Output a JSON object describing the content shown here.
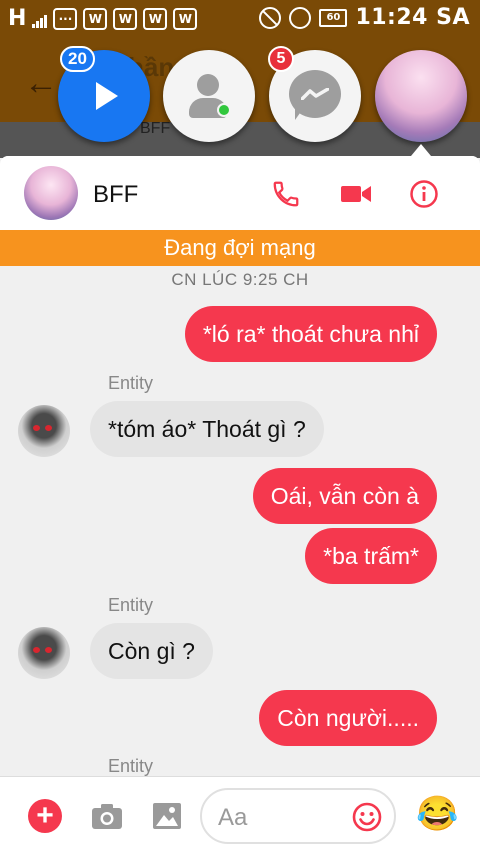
{
  "status_bar": {
    "carrier_glyph": "H",
    "time": "11:24 SA",
    "battery": "60",
    "notification_icons": [
      "W",
      "W",
      "W",
      "W"
    ]
  },
  "background_app": {
    "back_icon": "arrow-left-icon",
    "title_fragment": "hần",
    "sub_fragment": "BFF"
  },
  "chat_heads": [
    {
      "name": "video-player-head",
      "badge": "20",
      "icon": "play-icon"
    },
    {
      "name": "active-contacts-head",
      "icon": "person-online-icon"
    },
    {
      "name": "messenger-head",
      "badge": "5",
      "icon": "messenger-icon"
    },
    {
      "name": "bff-head",
      "icon": "avatar"
    }
  ],
  "chat": {
    "contact_name": "BFF",
    "banner": "Đang đợi mạng",
    "timestamp": "CN LÚC 9:25 CH",
    "colors": {
      "accent": "#f5384e",
      "banner": "#f7931e",
      "incoming": "#e4e4e4"
    },
    "messages": [
      {
        "from": "me",
        "text": "*ló ra* thoát chưa nhỉ"
      },
      {
        "from": "them",
        "sender": "Entity",
        "text": "*tóm áo* Thoát gì ?"
      },
      {
        "from": "me",
        "text": "Oái, vẫn còn à"
      },
      {
        "from": "me",
        "text": "*ba trấm*"
      },
      {
        "from": "them",
        "sender": "Entity",
        "text": "Còn gì ?"
      },
      {
        "from": "me",
        "text": "Còn người....."
      },
      {
        "from": "them",
        "sender": "Entity",
        "text": ""
      }
    ]
  },
  "composer": {
    "placeholder": "Aa",
    "icons": [
      "plus-icon",
      "camera-icon",
      "photo-icon",
      "smiley-icon",
      "laughing-emoji-icon"
    ],
    "emoji": "😂"
  }
}
